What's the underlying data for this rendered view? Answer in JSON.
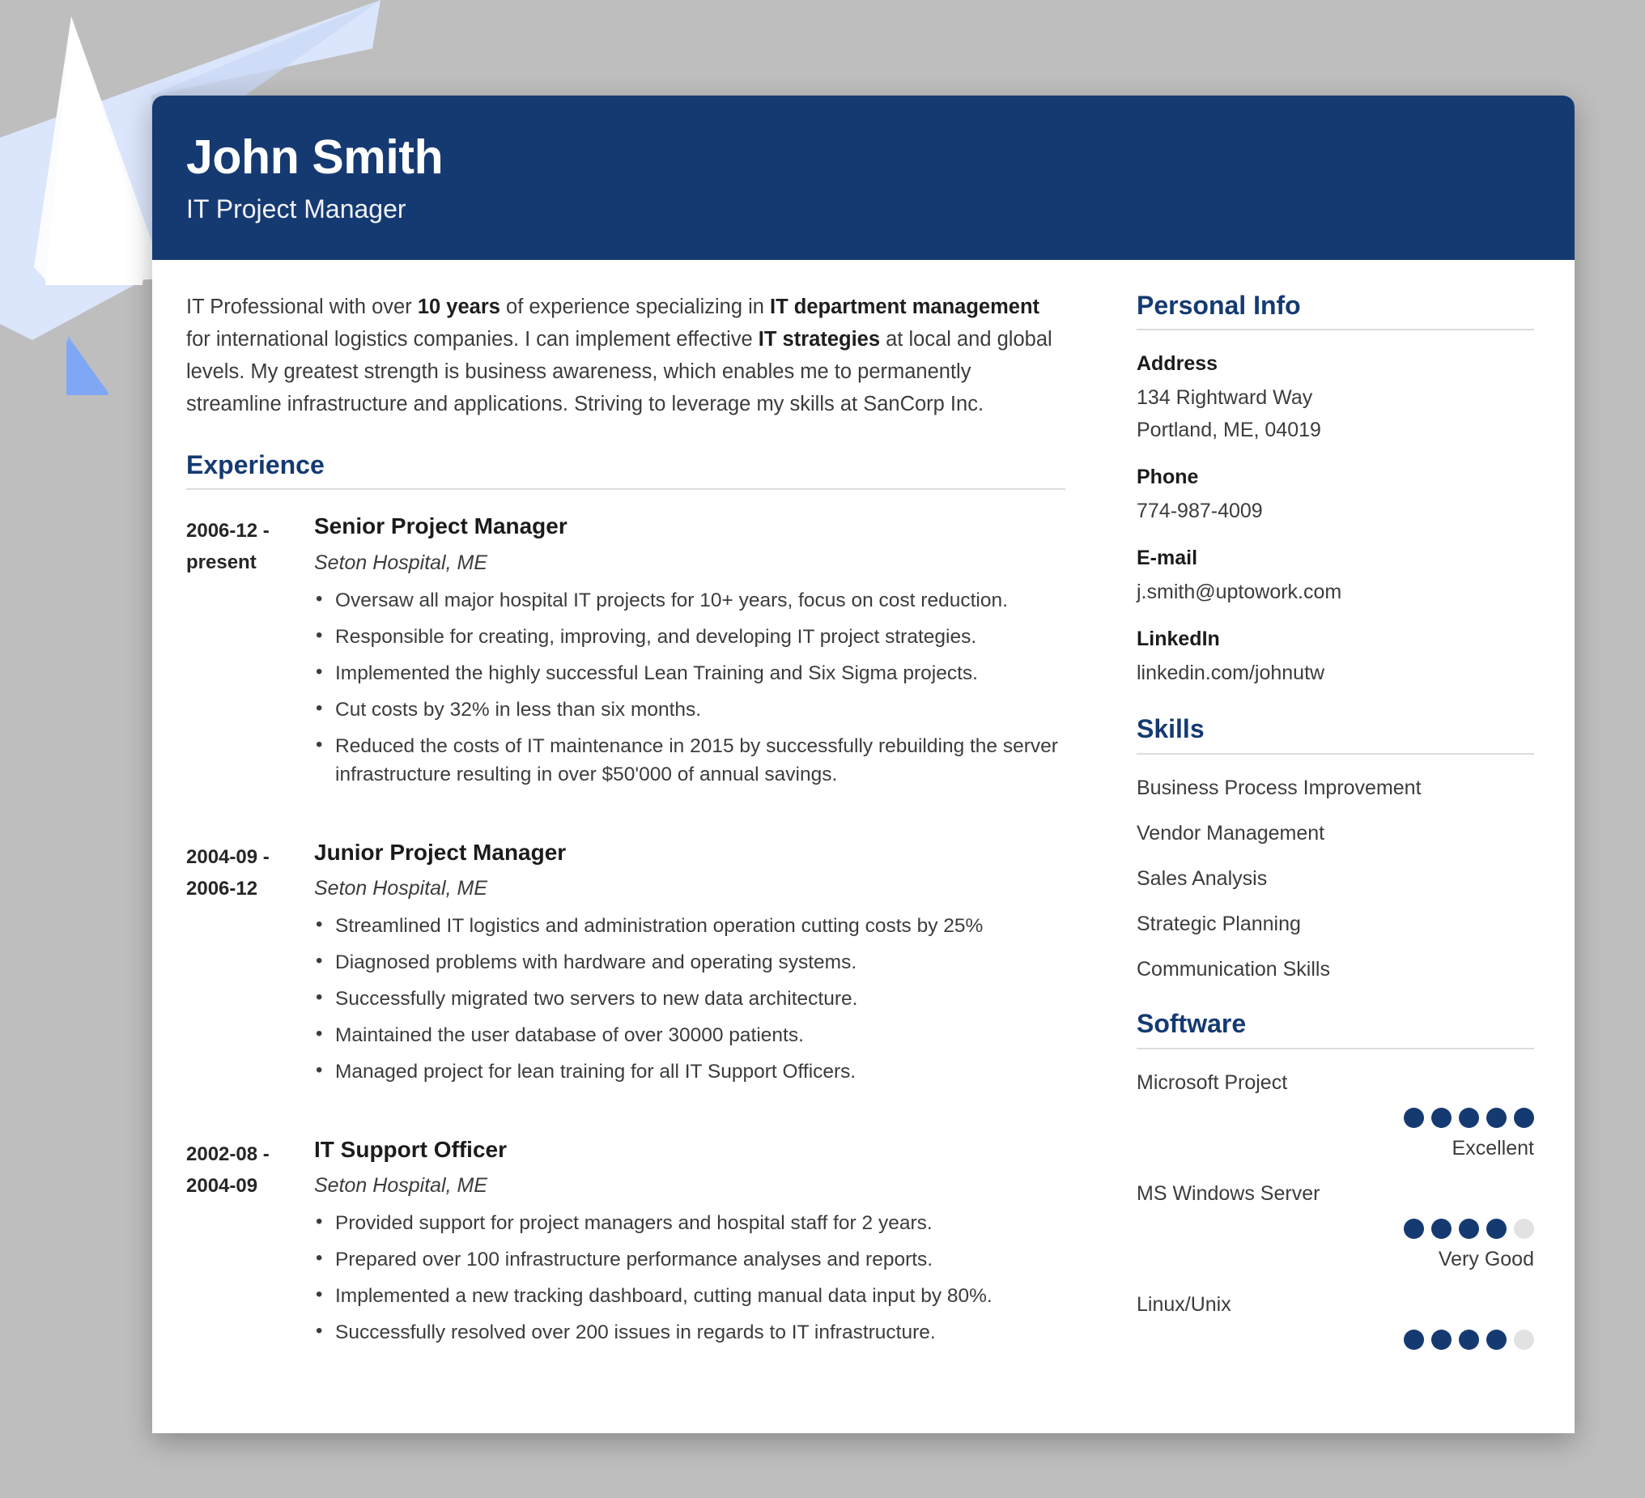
{
  "colors": {
    "navy": "#153a72",
    "page_bg": "#bebebe",
    "card_bg": "#ffffff",
    "rule": "#dcdcdc",
    "dot_filled": "#153a72",
    "dot_empty": "#e2e2e2",
    "decor_blue": "#7fa7f5",
    "decor_pale_blue": "#dbe5fb",
    "decor_white": "#fbfcfe"
  },
  "header": {
    "name": "John Smith",
    "title": "IT Project Manager"
  },
  "summary": {
    "parts": [
      {
        "text": "IT Professional with over ",
        "bold": false
      },
      {
        "text": "10 years",
        "bold": true
      },
      {
        "text": " of experience specializing in ",
        "bold": false
      },
      {
        "text": "IT department management",
        "bold": true
      },
      {
        "text": " for international logistics companies. I can implement effective ",
        "bold": false
      },
      {
        "text": "IT strategies",
        "bold": true
      },
      {
        "text": " at local and global levels. My greatest strength is business awareness, which enables me to permanently streamline infrastructure and applications. Striving to leverage my skills at SanCorp Inc.",
        "bold": false
      }
    ]
  },
  "experience": {
    "heading": "Experience",
    "entries": [
      {
        "date_from": "2006-12 -",
        "date_to": "present",
        "role": "Senior Project Manager",
        "company": "Seton Hospital, ME",
        "bullets": [
          "Oversaw all major hospital IT projects for 10+ years, focus on cost reduction.",
          "Responsible for creating, improving, and developing IT project strategies.",
          "Implemented the highly successful Lean Training and Six Sigma projects.",
          "Cut costs by 32% in less than six months.",
          "Reduced the costs of IT maintenance in 2015 by successfully rebuilding the server infrastructure resulting in over $50'000 of annual savings."
        ]
      },
      {
        "date_from": "2004-09 -",
        "date_to": "2006-12",
        "role": "Junior Project Manager",
        "company": "Seton Hospital, ME",
        "bullets": [
          "Streamlined IT logistics and administration operation cutting costs by 25%",
          "Diagnosed problems with hardware and operating systems.",
          "Successfully migrated two servers to new data architecture.",
          "Maintained the user database of over 30000 patients.",
          "Managed project for lean training for all IT Support Officers."
        ]
      },
      {
        "date_from": "2002-08 -",
        "date_to": "2004-09",
        "role": "IT Support Officer",
        "company": "Seton Hospital, ME",
        "bullets": [
          "Provided support for project managers and hospital staff for 2 years.",
          "Prepared over 100 infrastructure performance analyses and reports.",
          "Implemented a new tracking dashboard, cutting manual data input by 80%.",
          "Successfully resolved over 200 issues in regards to IT infrastructure."
        ]
      }
    ]
  },
  "personal_info": {
    "heading": "Personal Info",
    "fields": [
      {
        "label": "Address",
        "values": [
          "134 Rightward Way",
          "Portland, ME, 04019"
        ]
      },
      {
        "label": "Phone",
        "values": [
          "774-987-4009"
        ]
      },
      {
        "label": "E-mail",
        "values": [
          "j.smith@uptowork.com"
        ]
      },
      {
        "label": "LinkedIn",
        "values": [
          "linkedin.com/johnutw"
        ]
      }
    ]
  },
  "skills": {
    "heading": "Skills",
    "items": [
      "Business Process Improvement",
      "Vendor Management",
      "Sales Analysis",
      "Strategic Planning",
      "Communication Skills"
    ]
  },
  "software": {
    "heading": "Software",
    "max_dots": 5,
    "items": [
      {
        "name": "Microsoft Project",
        "rating": 5,
        "level": "Excellent"
      },
      {
        "name": "MS Windows Server",
        "rating": 4,
        "level": "Very Good"
      },
      {
        "name": "Linux/Unix",
        "rating": 4,
        "level": ""
      }
    ]
  }
}
